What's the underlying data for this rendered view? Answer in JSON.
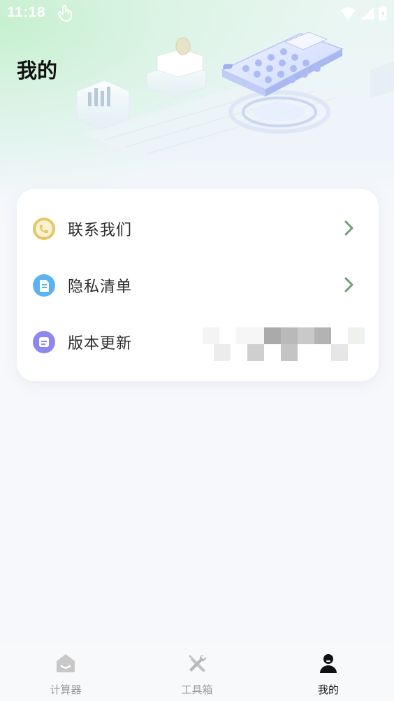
{
  "status_bar": {
    "time": "11:18"
  },
  "page_title": "我的",
  "menu": [
    {
      "label": "联系我们",
      "icon": "phone-icon",
      "color": "#e6c766"
    },
    {
      "label": "隐私清单",
      "icon": "document-icon",
      "color": "#5ab4f4"
    },
    {
      "label": "版本更新",
      "icon": "update-icon",
      "color": "#8c88f0"
    }
  ],
  "tabbar": {
    "tabs": [
      {
        "label": "计算器",
        "icon": "home-icon",
        "active": false
      },
      {
        "label": "工具箱",
        "icon": "tools-icon",
        "active": false
      },
      {
        "label": "我的",
        "icon": "user-icon",
        "active": true
      }
    ]
  },
  "colors": {
    "accent_chevron": "#6f9d77",
    "active_tab": "#111111",
    "inactive_tab": "#9a9a9a"
  }
}
